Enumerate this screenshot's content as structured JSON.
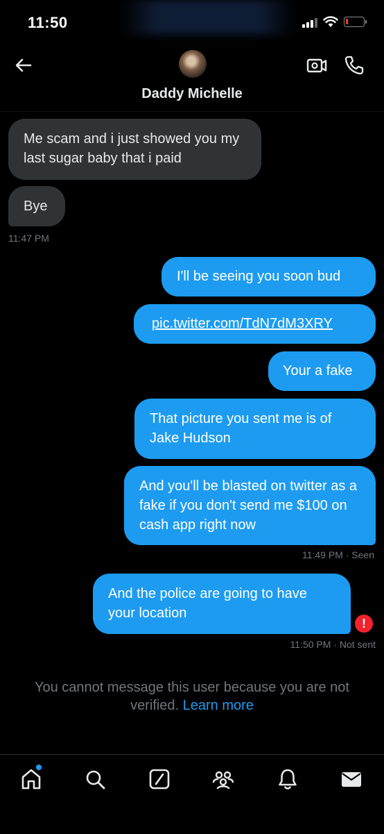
{
  "status_bar": {
    "time": "11:50",
    "battery_level": 0.12,
    "colors": {
      "battery_low": "#ff3b30"
    }
  },
  "header": {
    "title": "Daddy Michelle",
    "back_icon": "arrow-left-icon",
    "video_icon": "video-call-icon",
    "phone_icon": "phone-icon"
  },
  "messages": [
    {
      "direction": "in",
      "text": "Me scam and i just showed you my last sugar baby that i paid"
    },
    {
      "direction": "in",
      "text": "Bye"
    },
    {
      "type": "timestamp",
      "text": "11:47 PM"
    },
    {
      "direction": "out",
      "text": "I'll be seeing you soon bud"
    },
    {
      "direction": "out",
      "text": "pic.twitter.com/TdN7dM3XRY",
      "link": true
    },
    {
      "direction": "out",
      "text": "Your a fake"
    },
    {
      "direction": "out",
      "text": "That picture you sent me is of Jake Hudson"
    },
    {
      "direction": "out",
      "text": "And you'll be blasted on twitter as a fake if you don't send me $100 on cash app right now"
    },
    {
      "type": "timestamp",
      "text": "11:49 PM · Seen"
    },
    {
      "direction": "out",
      "text": "And the police are going to have your location"
    },
    {
      "type": "timestamp",
      "text": "11:50 PM · Not sent"
    }
  ],
  "error_icon": "!",
  "notice": {
    "text": "You cannot message this user because you are not verified. ",
    "link": "Learn more"
  },
  "tab_bar": {
    "items": [
      "home-icon",
      "search-icon",
      "grok-icon",
      "communities-icon",
      "notifications-icon",
      "messages-icon"
    ]
  },
  "colors": {
    "background": "#000000",
    "incoming_bubble": "#2f3336",
    "outgoing_bubble": "#1d9bf0",
    "meta_text": "#71767b",
    "error": "#f4212e"
  }
}
